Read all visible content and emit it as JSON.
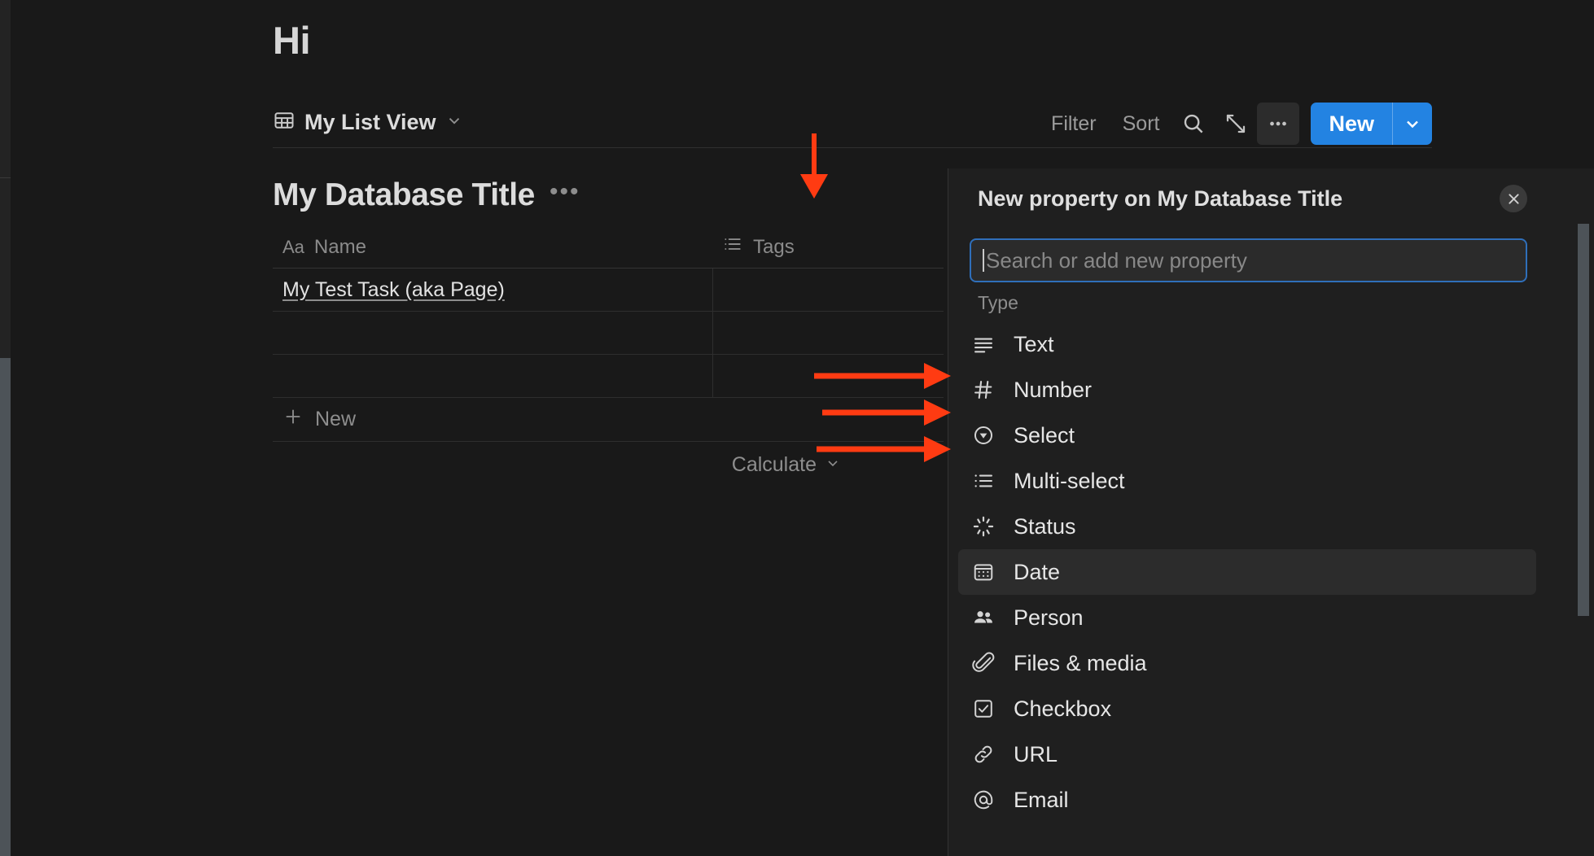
{
  "page": {
    "title": "Hi"
  },
  "view_bar": {
    "view_icon": "table-icon",
    "view_name": "My List View",
    "view_chevron": "chevron-down-icon",
    "filter_label": "Filter",
    "sort_label": "Sort",
    "search_icon": "search-icon",
    "expand_icon": "expand-diagonal-icon",
    "more_icon": "ellipsis-icon",
    "new_label": "New",
    "new_chevron": "chevron-down-icon",
    "new_button_color": "#2383e2"
  },
  "database": {
    "title": "My Database Title",
    "title_menu_icon": "ellipsis-icon",
    "columns": [
      {
        "label": "Name",
        "icon": "aa-text-icon",
        "icon_glyph": "Aa"
      },
      {
        "label": "Tags",
        "icon": "multi-select-list-icon"
      }
    ],
    "rows": [
      {
        "name": "My Test Task (aka Page)",
        "tags": ""
      },
      {
        "name": "",
        "tags": ""
      },
      {
        "name": "",
        "tags": ""
      }
    ],
    "new_row_label": "New",
    "new_row_icon": "plus-icon",
    "calculate_label": "Calculate",
    "calculate_chevron": "chevron-down-icon"
  },
  "panel": {
    "title": "New property on My Database Title",
    "close_icon": "close-icon",
    "search": {
      "value": "",
      "placeholder": "Search or add new property"
    },
    "section_label": "Type",
    "selected_type": "Date",
    "types": [
      {
        "label": "Text",
        "icon": "text-lines-icon"
      },
      {
        "label": "Number",
        "icon": "hash-icon"
      },
      {
        "label": "Select",
        "icon": "select-circle-caret-icon"
      },
      {
        "label": "Multi-select",
        "icon": "multi-select-list-icon"
      },
      {
        "label": "Status",
        "icon": "status-spinner-icon"
      },
      {
        "label": "Date",
        "icon": "calendar-icon"
      },
      {
        "label": "Person",
        "icon": "people-icon"
      },
      {
        "label": "Files & media",
        "icon": "paperclip-icon"
      },
      {
        "label": "Checkbox",
        "icon": "checkbox-checked-icon"
      },
      {
        "label": "URL",
        "icon": "link-icon"
      },
      {
        "label": "Email",
        "icon": "at-sign-icon"
      }
    ]
  },
  "annotations": {
    "color": "#ff3b12",
    "arrows": [
      {
        "name": "arrow-to-tags-column",
        "direction": "down",
        "target": "Tags"
      },
      {
        "name": "arrow-to-select-type",
        "direction": "right",
        "target": "Select"
      },
      {
        "name": "arrow-to-multi-select-type",
        "direction": "right",
        "target": "Multi-select"
      },
      {
        "name": "arrow-to-status-type",
        "direction": "right",
        "target": "Status"
      }
    ]
  }
}
